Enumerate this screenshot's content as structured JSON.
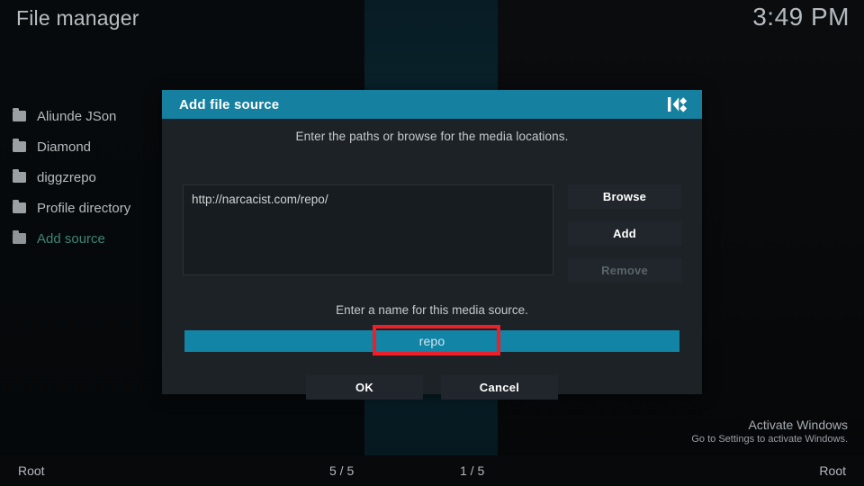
{
  "topbar": {
    "app_title": "File manager",
    "clock": "3:49 PM"
  },
  "sidebar": {
    "items": [
      {
        "label": "Aliunde JSon",
        "icon": "folder-icon",
        "active": false
      },
      {
        "label": "Diamond",
        "icon": "folder-icon",
        "active": false
      },
      {
        "label": "diggzrepo",
        "icon": "folder-icon",
        "active": false
      },
      {
        "label": "Profile directory",
        "icon": "folder-icon",
        "active": false
      },
      {
        "label": "Add source",
        "icon": "folder-icon",
        "active": true
      }
    ]
  },
  "dialog": {
    "title": "Add file source",
    "logo_icon": "kodi-logo-icon",
    "paths_hint": "Enter the paths or browse for the media locations.",
    "path_value": "http://narcacist.com/repo/",
    "buttons": {
      "browse": "Browse",
      "add": "Add",
      "remove": "Remove"
    },
    "remove_disabled": true,
    "name_hint": "Enter a name for this media source.",
    "name_value": "repo",
    "ok": "OK",
    "cancel": "Cancel"
  },
  "annotation": {
    "highlight_color": "#f01e28",
    "target": "name-field"
  },
  "watermark": {
    "title": "Activate Windows",
    "subtitle": "Go to Settings to activate Windows."
  },
  "statusbar": {
    "left": "Root",
    "middle_left": "5 / 5",
    "middle_right": "1 / 5",
    "right": "Root"
  },
  "colors": {
    "accent": "#15809f",
    "field_accent": "#1284a6",
    "active_item": "#3e8475",
    "annotation": "#f01e28"
  }
}
